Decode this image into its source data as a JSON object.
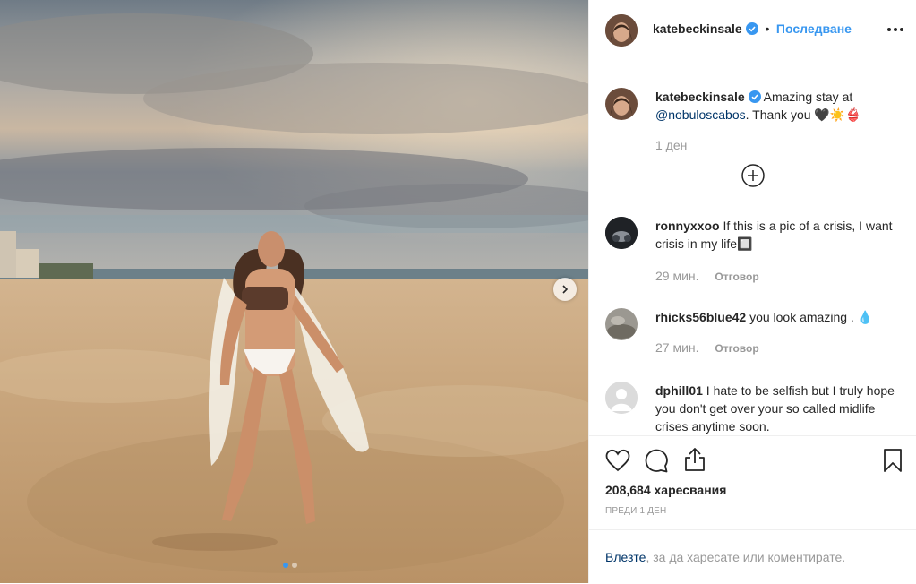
{
  "post": {
    "author": "katebeckinsale",
    "follow_label": "Последване",
    "separator": "•",
    "caption": {
      "text": "Amazing stay at",
      "mention": "@nobuloscabos",
      "text_after": ". Thank you 🖤☀️👙",
      "time": "1 ден"
    },
    "comments": [
      {
        "user": "ronnyxxoo",
        "text": "If this is a pic of a crisis, I want crisis in my life🔲",
        "time": "29 мин.",
        "reply_label": "Отговор"
      },
      {
        "user": "rhicks56blue42",
        "text": "you look amazing . 💧",
        "time": "27 мин.",
        "reply_label": "Отговор"
      },
      {
        "user": "dphill01",
        "text": "I hate to be selfish but I truly hope you don't get over your so called midlife crises anytime soon."
      }
    ],
    "likes": "208,684 харесвания",
    "timestamp": "ПРЕДИ 1 ДЕН",
    "login": {
      "link": "Влезте",
      "text": ", за да харесате или коментирате."
    },
    "carousel": {
      "total": 2,
      "active": 0
    }
  },
  "colors": {
    "accent": "#3897f0",
    "verified": "#3897f0",
    "muted": "#999999"
  },
  "icons": [
    "plus-circle-icon",
    "heart-icon",
    "comment-icon",
    "share-icon",
    "bookmark-icon",
    "chevron-right-icon",
    "verified-icon",
    "more-icon"
  ]
}
